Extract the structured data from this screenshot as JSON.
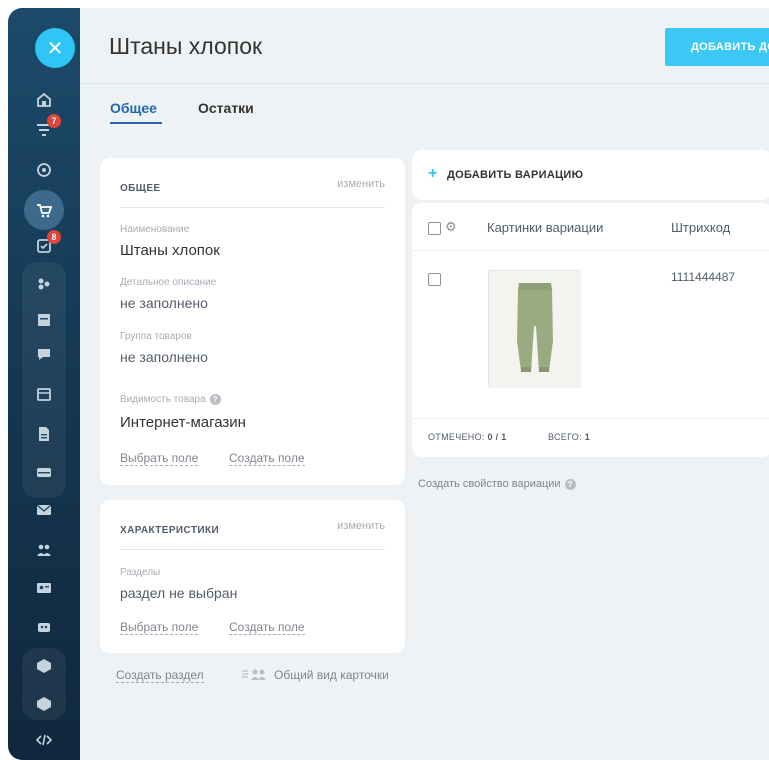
{
  "header": {
    "title": "Штаны хлопок",
    "add_button_label": "ДОБАВИТЬ ДОВАР"
  },
  "tabs": [
    {
      "label": "Общее",
      "active": true
    },
    {
      "label": "Остатки",
      "active": false
    }
  ],
  "rail": {
    "badges": {
      "filter": "7",
      "tasks": "8"
    },
    "accent": "#2fc6f6"
  },
  "general_card": {
    "title": "ОБЩЕЕ",
    "edit_label": "изменить",
    "fields": [
      {
        "label": "Наименование",
        "value": "Штаны хлопок"
      },
      {
        "label": "Детальное описание",
        "value": "не заполнено"
      },
      {
        "label": "Группа товаров",
        "value": "не заполнено"
      },
      {
        "label": "Видимость товара",
        "value": "Интернет-магазин"
      }
    ],
    "select_field": "Выбрать поле",
    "create_field": "Создать поле"
  },
  "features_card": {
    "title": "ХАРАКТЕРИСТИКИ",
    "edit_label": "изменить",
    "field_label": "Разделы",
    "field_value": "раздел не выбран",
    "select_field": "Выбрать поле",
    "create_field": "Создать поле"
  },
  "bottom_links": {
    "create_section": "Создать раздел",
    "card_view": "Общий вид карточки"
  },
  "variations": {
    "add_label": "ДОБАВИТЬ ВАРИАЦИЮ",
    "columns": [
      "Картинки вариации",
      "Штрихкод"
    ],
    "rows": [
      {
        "image": "green-pants",
        "barcode": "1111444487"
      }
    ],
    "footer": {
      "checked_label": "ОТМЕЧЕНО:",
      "checked_value": "0 / 1",
      "total_label": "ВСЕГО:",
      "total_value": "1"
    },
    "create_property": "Создать свойство вариации"
  },
  "colors": {
    "accent": "#2fc6f6",
    "link_blue": "#2067b0",
    "rail_bg": "#1d4a6a",
    "badge_red": "#e0453a"
  }
}
